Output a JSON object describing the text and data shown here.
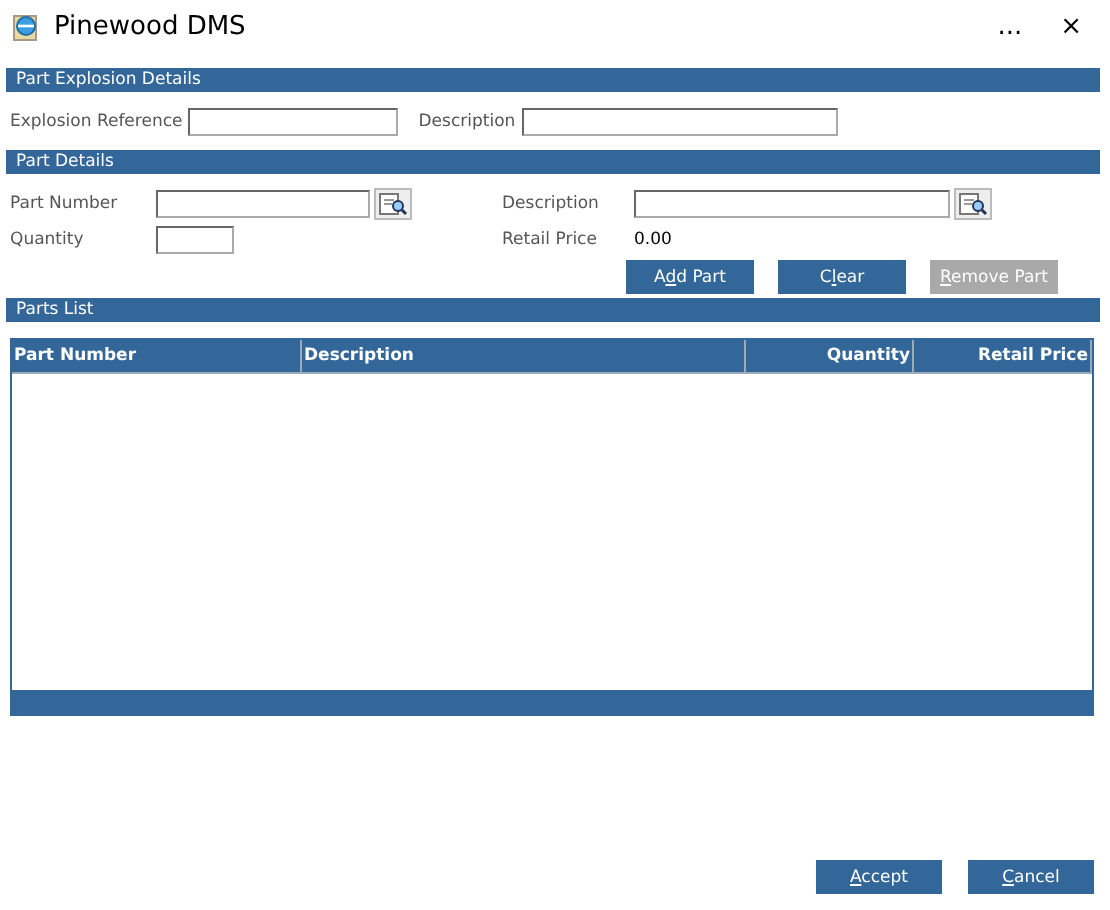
{
  "window": {
    "title": "Pinewood DMS",
    "more": "...",
    "close": "×"
  },
  "explosion_section": {
    "title": "Part Explosion Details",
    "fields": [
      {
        "label": "Explosion Reference"
      },
      {
        "label": "Description"
      }
    ]
  },
  "part_section": {
    "title": "Part Details",
    "part_number": {
      "label": "Part Number"
    },
    "description": {
      "label": "Description"
    },
    "quantity": {
      "label": "Quantity"
    },
    "retail_price": {
      "label": "Retail Price",
      "value": "0.00"
    },
    "buttons": [
      {
        "before": "A",
        "key": "d",
        "after": "d Part",
        "disabled": false
      },
      {
        "before": "C",
        "key": "l",
        "after": "ear",
        "disabled": false
      },
      {
        "key": "R",
        "after": "emove Part",
        "disabled": true
      }
    ]
  },
  "parts_list": {
    "title": "Parts List",
    "columns": [
      {
        "label": "Part Number",
        "kind": "text"
      },
      {
        "label": "Description",
        "kind": "text"
      },
      {
        "label": "Quantity",
        "kind": "number"
      },
      {
        "label": "Retail Price",
        "kind": "number"
      }
    ]
  },
  "footer_buttons": [
    {
      "key": "A",
      "after": "ccept"
    },
    {
      "key": "C",
      "after": "ancel"
    }
  ]
}
